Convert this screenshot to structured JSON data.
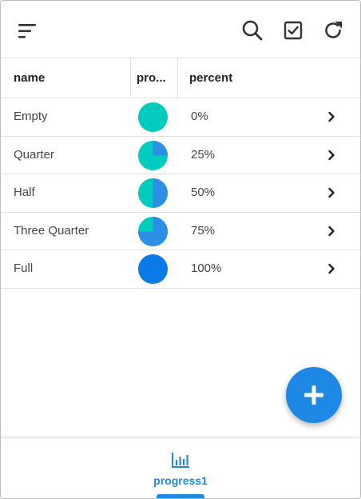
{
  "colors": {
    "accent": "#1e88e5",
    "pie_empty": "#00cbbf",
    "pie_fill": "#2b8fe6",
    "pie_full": "#0a7be6"
  },
  "toolbar": {
    "menu_icon": "sort-menu-icon",
    "search_icon": "search-icon",
    "select_icon": "checkbox-checked-icon",
    "refresh_icon": "refresh-icon"
  },
  "table": {
    "columns": [
      {
        "key": "name",
        "label": "name"
      },
      {
        "key": "progress",
        "label": "pro..."
      },
      {
        "key": "percent",
        "label": "percent"
      }
    ],
    "rows": [
      {
        "name": "Empty",
        "percent": "0%",
        "progress": 0
      },
      {
        "name": "Quarter",
        "percent": "25%",
        "progress": 0.25
      },
      {
        "name": "Half",
        "percent": "50%",
        "progress": 0.5
      },
      {
        "name": "Three Quarter",
        "percent": "75%",
        "progress": 0.75
      },
      {
        "name": "Full",
        "percent": "100%",
        "progress": 1
      }
    ]
  },
  "fab": {
    "icon": "plus-icon"
  },
  "bottom_nav": {
    "tabs": [
      {
        "label": "progress1",
        "icon": "bar-chart-icon",
        "active": true
      }
    ]
  }
}
